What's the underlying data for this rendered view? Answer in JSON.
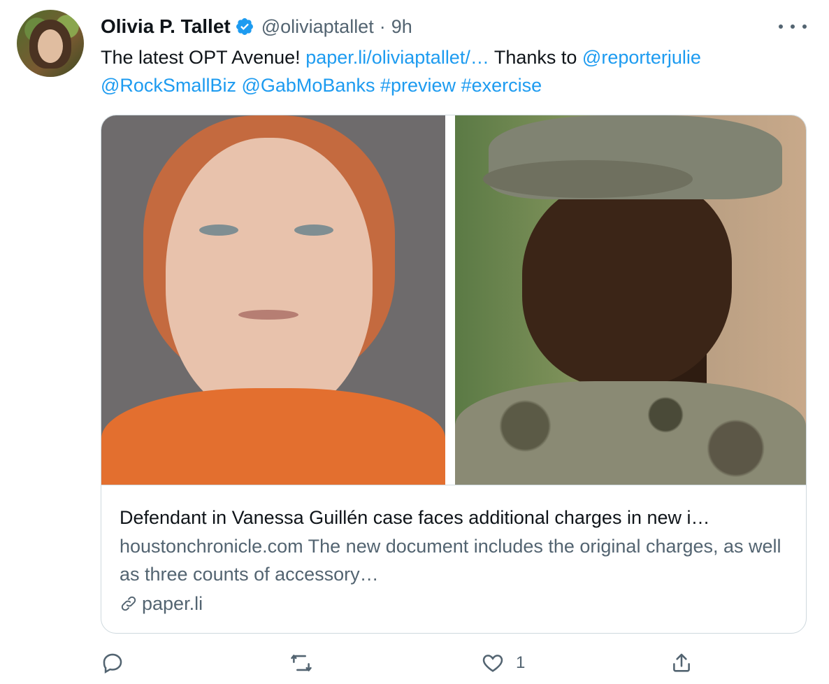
{
  "tweet": {
    "display_name": "Olivia P. Tallet",
    "handle": "@oliviaptallet",
    "separator": "·",
    "time": "9h",
    "text_parts": {
      "t1": "The latest OPT Avenue! ",
      "link_url": "paper.li/oliviaptallet/…",
      "t2": " Thanks to ",
      "mention1": "@reporterjulie",
      "mention2": "@RockSmallBiz",
      "mention3": "@GabMoBanks",
      "hashtag1": "#preview",
      "hashtag2": "#exercise"
    }
  },
  "card": {
    "title": "Defendant in Vanessa Guillén case faces additional charges in new i…",
    "description": "houstonchronicle.com The new document includes the original charges, as well as three counts of accessory…",
    "source": "paper.li"
  },
  "actions": {
    "reply": "reply-icon",
    "retweet": "retweet-icon",
    "like": "heart-icon",
    "like_count": "1",
    "share": "share-icon"
  },
  "colors": {
    "link": "#1d9bf0",
    "verified": "#1d9bf0",
    "secondary_text": "#536471",
    "border": "#cfd9de"
  }
}
